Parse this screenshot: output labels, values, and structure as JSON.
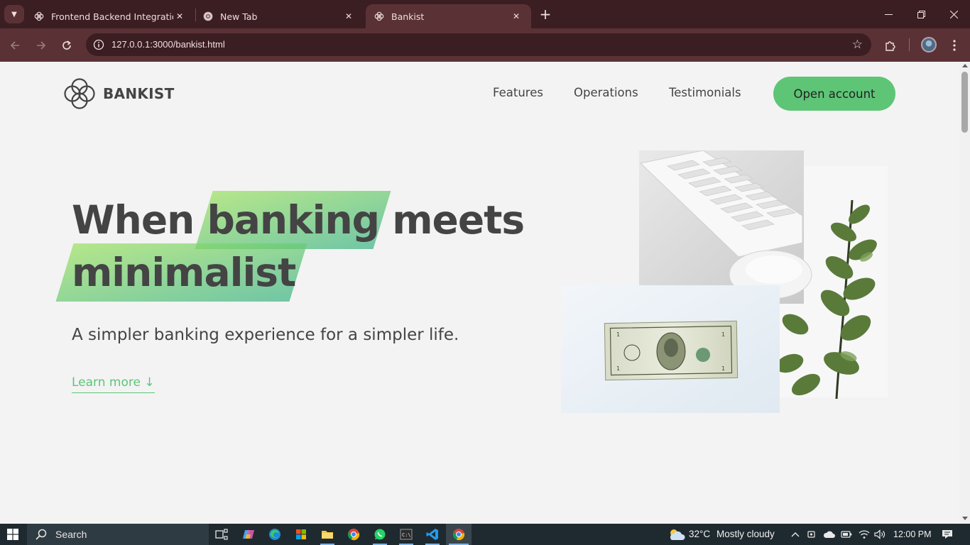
{
  "browser": {
    "tabs": [
      {
        "title": "Frontend Backend Integration",
        "active": false
      },
      {
        "title": "New Tab",
        "active": false
      },
      {
        "title": "Bankist",
        "active": true
      }
    ],
    "url": "127.0.0.1:3000/bankist.html"
  },
  "page": {
    "logo_text": "BANKIST",
    "nav": {
      "links": [
        "Features",
        "Operations",
        "Testimonials"
      ],
      "cta": "Open account"
    },
    "hero": {
      "title_word_1": "When",
      "title_highlight_1": "banking",
      "title_word_2": "meets",
      "title_highlight_2": "minimalist",
      "subtitle": "A simpler banking experience for a simpler life.",
      "learn_more": "Learn more ↓"
    },
    "colors": {
      "accent": "#5ec576",
      "gradient_start": "#9be15d",
      "gradient_end": "#39b385",
      "text": "#444444"
    }
  },
  "taskbar": {
    "search_label": "Search",
    "weather": "32°C",
    "weather_desc": "Mostly cloudy",
    "time": "12:00 PM",
    "apps": [
      "task-view",
      "copilot",
      "edge",
      "microsoft-store",
      "file-explorer",
      "chrome",
      "whatsapp",
      "terminal",
      "vscode",
      "chrome-active"
    ]
  }
}
